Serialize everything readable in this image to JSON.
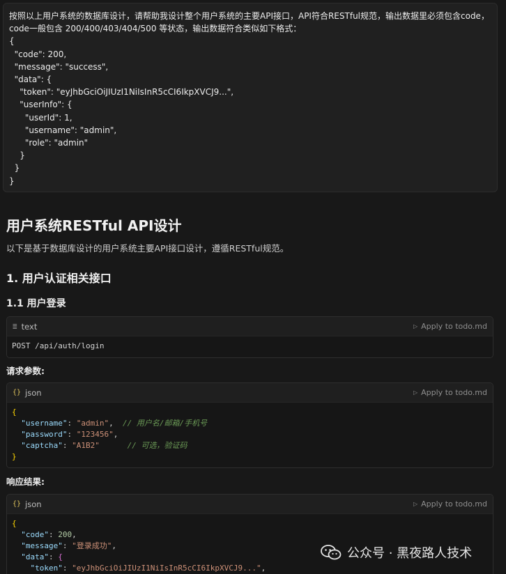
{
  "prompt": {
    "lines": [
      "按照以上用户系统的数据库设计，请帮助我设计整个用户系统的主要API接口，API符合RESTful规范，输出数据里必须包含code，",
      "code一般包含 200/400/403/404/500 等状态，输出数据符合类似如下格式：",
      "{",
      "  \"code\": 200,",
      "  \"message\": \"success\",",
      "  \"data\": {",
      "    \"token\": \"eyJhbGciOiJIUzI1NiIsInR5cCI6IkpXVCJ9...\",",
      "    \"userInfo\": {",
      "      \"userId\": 1,",
      "      \"username\": \"admin\",",
      "      \"role\": \"admin\"",
      "    }",
      "  }",
      "}"
    ]
  },
  "response": {
    "title": "用户系统RESTful API设计",
    "intro": "以下是基于数据库设计的用户系统主要API接口设计，遵循RESTful规范。",
    "section1": "1. 用户认证相关接口",
    "subsection1": "1.1 用户登录",
    "label_params": "请求参数:",
    "label_response": "响应结果:"
  },
  "codeblocks": {
    "endpoint": {
      "lang": "text",
      "apply": "Apply to todo.md",
      "code": "POST /api/auth/login"
    },
    "request": {
      "lang": "json",
      "apply": "Apply to todo.md",
      "brace_open": "{",
      "brace_close": "}",
      "rows": [
        {
          "key": "\"username\"",
          "value": "\"admin\"",
          "sep": ",",
          "pad": "  ",
          "comment": "// 用户名/邮箱/手机号"
        },
        {
          "key": "\"password\"",
          "value": "\"123456\"",
          "sep": ",",
          "pad": "",
          "comment": ""
        },
        {
          "key": "\"captcha\"",
          "value": "\"A1B2\"",
          "sep": "",
          "pad": "      ",
          "comment": "// 可选，验证码"
        }
      ]
    },
    "response": {
      "lang": "json",
      "apply": "Apply to todo.md",
      "brace_open": "{",
      "code_key": "\"code\"",
      "code_value": "200",
      "message_key": "\"message\"",
      "message_value": "\"登录成功\"",
      "data_key": "\"data\"",
      "data_brace": "{",
      "token_key": "\"token\"",
      "token_value": "\"eyJhbGciOiJIUzI1NiIsInR5cCI6IkpXVCJ9...\""
    }
  },
  "watermark": {
    "text": "公众号 · 黑夜路人技术",
    "icon": "wechat-icon"
  }
}
